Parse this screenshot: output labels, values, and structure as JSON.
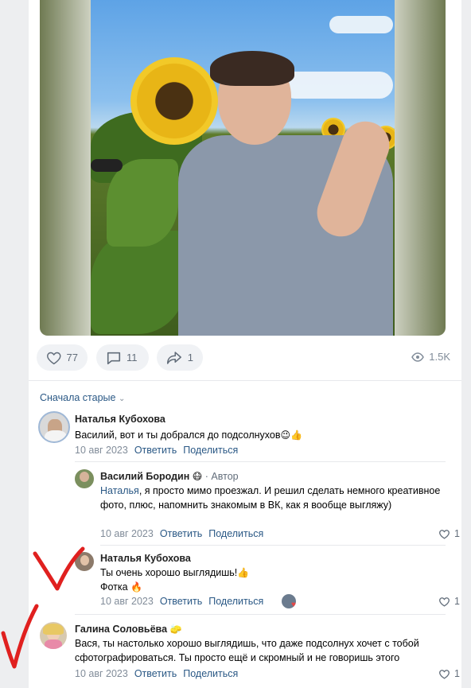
{
  "post": {
    "likes": "77",
    "comments": "11",
    "shares": "1",
    "views": "1.5K"
  },
  "sort_label": "Сначала старые",
  "comments": [
    {
      "author": "Наталья Кубохова",
      "text": "Василий, вот и ты добрался до подсолнухов",
      "emoji": "😉👍",
      "date": "10 авг 2023",
      "reply": "Ответить",
      "share": "Поделиться"
    },
    {
      "author": "Василий Бородин",
      "author_badge": "· Автор",
      "reply_to": "Наталья",
      "text": ", я просто мимо проезжал. И решил сделать немного креативное фото, плюс, напомнить знакомым в ВК, как я вообще выгляжу)",
      "date": "10 авг 2023",
      "reply": "Ответить",
      "share": "Поделиться",
      "likes": "1"
    },
    {
      "author": "Наталья Кубохова",
      "text_line1": "Ты очень хорошо выглядишь!",
      "emoji1": "👍",
      "text_line2": "Фотка",
      "emoji2": "🔥",
      "date": "10 авг 2023",
      "reply": "Ответить",
      "share": "Поделиться",
      "likes": "1"
    },
    {
      "author": "Галина Соловьёва",
      "text": "Вася, ты настолько хорошо выглядишь, что даже подсолнух хочет с тобой сфотографироваться. Ты просто ещё и скромный и не говоришь этого",
      "date": "10 авг 2023",
      "reply": "Ответить",
      "share": "Поделиться",
      "likes": "1"
    }
  ],
  "colors": {
    "link": "#2a5885",
    "muted": "#818c99",
    "pill_bg": "#f0f2f5",
    "annotation": "#e0201f"
  }
}
